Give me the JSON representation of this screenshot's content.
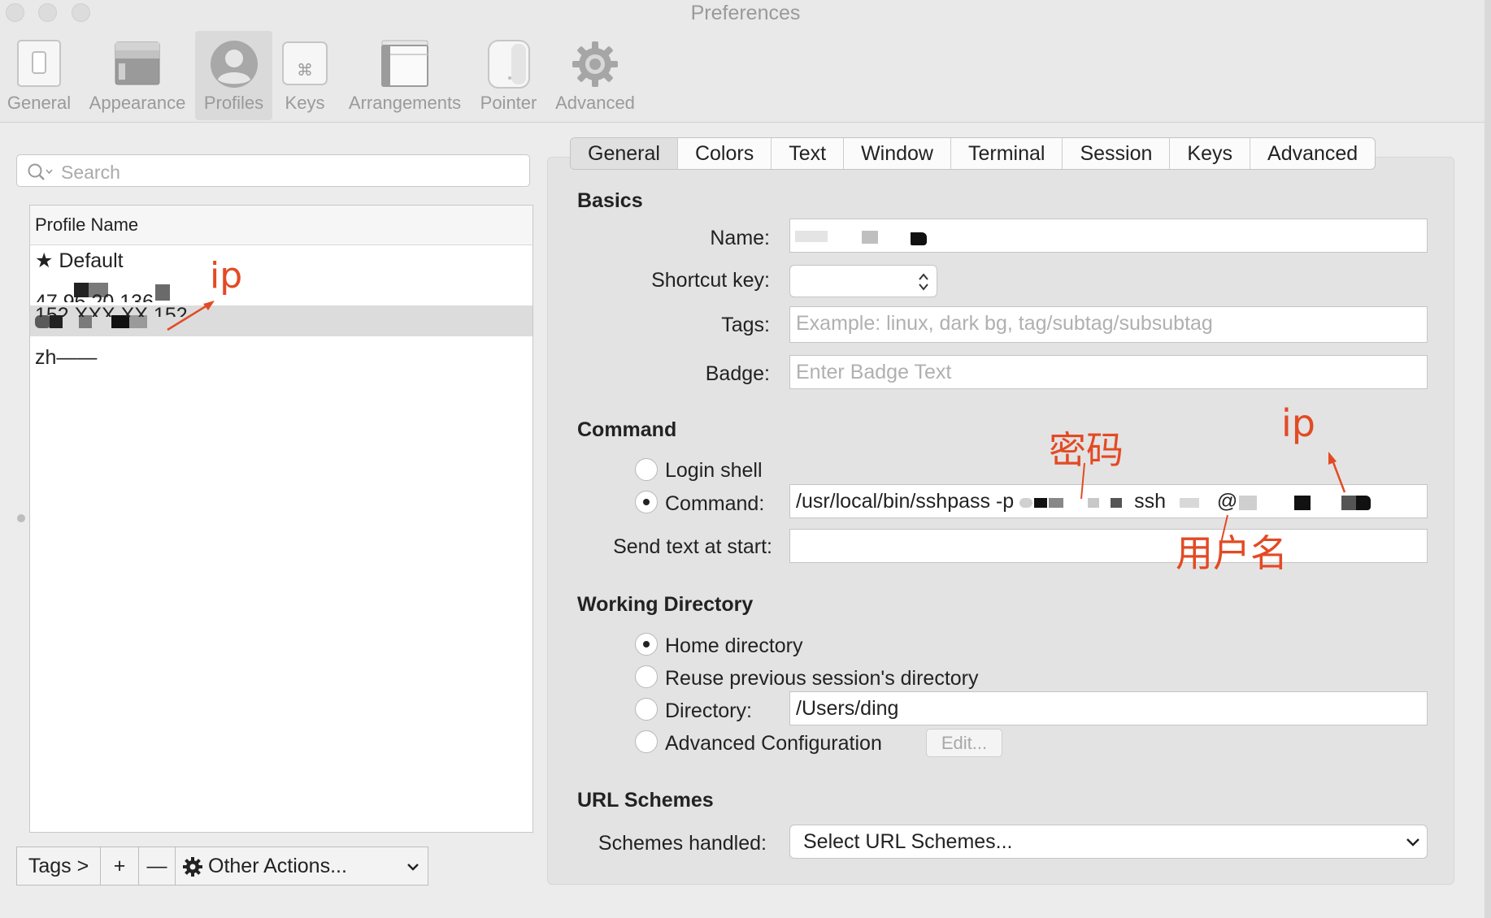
{
  "window": {
    "title": "Preferences"
  },
  "toolbar": {
    "items": [
      {
        "label": "General",
        "icon": "switch-icon"
      },
      {
        "label": "Appearance",
        "icon": "window-icon"
      },
      {
        "label": "Profiles",
        "icon": "user-avatar-icon"
      },
      {
        "label": "Keys",
        "icon": "command-key-icon"
      },
      {
        "label": "Arrangements",
        "icon": "windows-arrangement-icon"
      },
      {
        "label": "Pointer",
        "icon": "mouse-icon"
      },
      {
        "label": "Advanced",
        "icon": "gear-icon"
      }
    ],
    "selected": "Profiles"
  },
  "sidebar": {
    "search_placeholder": "Search",
    "table_header": "Profile Name",
    "profiles": [
      {
        "label": "Default",
        "starred": true
      },
      {
        "label": "47.96.20.136",
        "redacted": true
      },
      {
        "label": "152.XXX.XX.152",
        "redacted": true,
        "selected": true
      },
      {
        "label": "zh——"
      }
    ],
    "bottom": {
      "tags": "Tags >",
      "add": "+",
      "remove": "—",
      "other_actions": "Other Actions..."
    }
  },
  "tabs": [
    "General",
    "Colors",
    "Text",
    "Window",
    "Terminal",
    "Session",
    "Keys",
    "Advanced"
  ],
  "active_tab": "General",
  "basics": {
    "heading": "Basics",
    "name_label": "Name:",
    "name_value": "",
    "shortcut_label": "Shortcut key:",
    "tags_label": "Tags:",
    "tags_placeholder": "Example: linux, dark bg, tag/subtag/subsubtag",
    "badge_label": "Badge:",
    "badge_placeholder": "Enter Badge Text"
  },
  "command": {
    "heading": "Command",
    "login_shell": "Login shell",
    "command_label": "Command:",
    "command_value": "/usr/local/bin/sshpass -p ",
    "command_value_mid": " ssh ",
    "command_value_at": "@",
    "send_text_label": "Send text at start:",
    "selected": "Command"
  },
  "working_directory": {
    "heading": "Working Directory",
    "home": "Home directory",
    "reuse": "Reuse previous session's directory",
    "directory_label": "Directory:",
    "directory_value": "/Users/ding",
    "advanced": "Advanced Configuration",
    "edit_button": "Edit...",
    "selected": "Home directory"
  },
  "url_schemes": {
    "heading": "URL Schemes",
    "label": "Schemes handled:",
    "value": "Select URL Schemes..."
  },
  "annotations": {
    "ip_left": "ip",
    "password": "密码",
    "ip_right": "ip",
    "username": "用户名",
    "color": "#e34a24"
  }
}
